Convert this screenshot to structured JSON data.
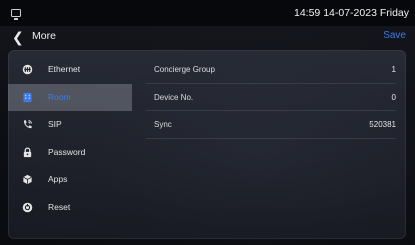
{
  "status_bar": {
    "datetime": "14:59 14-07-2023 Friday",
    "left_icon": "screen-icon"
  },
  "header": {
    "back_icon": "chevron-left-icon",
    "title": "More",
    "save_label": "Save"
  },
  "colors": {
    "accent": "#3d7be6",
    "background": "#0c0d12",
    "selected_item": "#787c87"
  },
  "sidebar": {
    "items": [
      {
        "label": "Ethernet",
        "icon": "ethernet-icon",
        "selected": false
      },
      {
        "label": "Room",
        "icon": "building-icon",
        "selected": true
      },
      {
        "label": "SIP",
        "icon": "phone-icon",
        "selected": false
      },
      {
        "label": "Password",
        "icon": "lock-icon",
        "selected": false
      },
      {
        "label": "Apps",
        "icon": "cube-icon",
        "selected": false
      },
      {
        "label": "Reset",
        "icon": "reset-icon",
        "selected": false
      }
    ]
  },
  "settings": {
    "rows": [
      {
        "label": "Concierge Group",
        "value": "1"
      },
      {
        "label": "Device No.",
        "value": "0"
      },
      {
        "label": "Sync",
        "value": "520381"
      }
    ]
  }
}
